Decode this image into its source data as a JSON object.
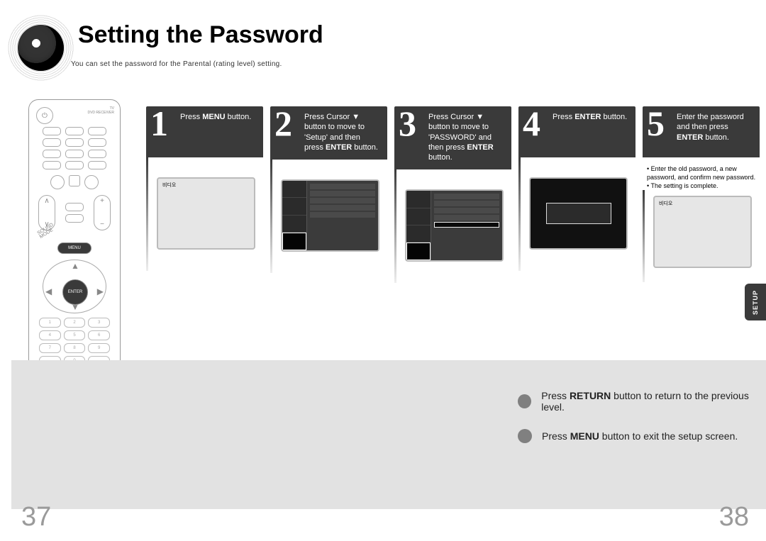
{
  "header": {
    "title": "Setting the Password",
    "subtitle": "You can set the password for the Parental (rating level) setting."
  },
  "remote": {
    "top_right_line1": "TV",
    "top_right_line2": "DVD RECEIVER",
    "menu_label": "MENU",
    "enter_label": "ENTER"
  },
  "steps": [
    {
      "num": "1",
      "html": "Press <b>MENU</b> button."
    },
    {
      "num": "2",
      "html": "Press Cursor ▼ button to move to 'Setup' and then press <b>ENTER</b> button."
    },
    {
      "num": "3",
      "html": "Press Cursor ▼ button to move to 'PASSWORD' and then press <b>ENTER</b> button."
    },
    {
      "num": "4",
      "html": "Press <b>ENTER</b> button."
    },
    {
      "num": "5",
      "html": "Enter the password and then press <b>ENTER</b> button."
    }
  ],
  "thumbs": {
    "blank_label": "비디오"
  },
  "notes_step5": [
    "Enter the old password, a new password, and confirm new password.",
    "The setting is complete."
  ],
  "setup_tab": "SETUP",
  "footer": {
    "note1_html": "Press <b>RETURN</b> button to return to the previous level.",
    "note2_html": "Press <b>MENU</b> button to exit the setup screen.",
    "page_left": "37",
    "page_right": "38"
  }
}
